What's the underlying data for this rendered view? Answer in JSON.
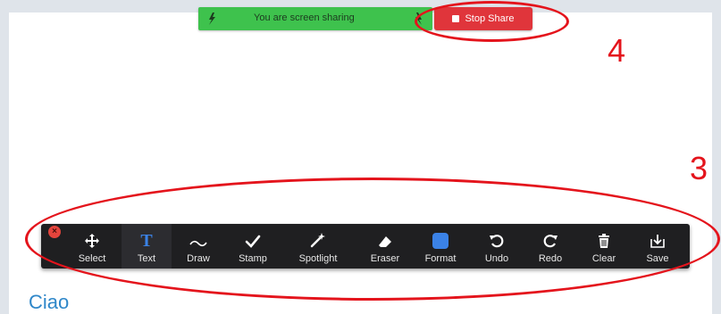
{
  "share_bar": {
    "status_text": "You are screen sharing",
    "stop_label": "Stop Share"
  },
  "annotations": {
    "number_4": "4",
    "number_3": "3"
  },
  "toolbar": {
    "tools": [
      {
        "label": "Select",
        "icon": "move-icon"
      },
      {
        "label": "Text",
        "icon": "text-icon",
        "active": true
      },
      {
        "label": "Draw",
        "icon": "draw-icon"
      },
      {
        "label": "Stamp",
        "icon": "checkmark-icon"
      },
      {
        "label": "Spotlight",
        "icon": "wand-icon"
      },
      {
        "label": "Eraser",
        "icon": "eraser-icon"
      },
      {
        "label": "Format",
        "icon": "format-square-icon"
      },
      {
        "label": "Undo",
        "icon": "undo-icon"
      },
      {
        "label": "Redo",
        "icon": "redo-icon"
      },
      {
        "label": "Clear",
        "icon": "trash-icon"
      },
      {
        "label": "Save",
        "icon": "save-icon"
      }
    ]
  },
  "content": {
    "text": "Ciao"
  },
  "colors": {
    "share_green": "#3ec24d",
    "stop_red": "#e0353b",
    "annotation_red": "#e4141c",
    "format_blue": "#3b82e6",
    "ciao_blue": "#2f87c9"
  }
}
